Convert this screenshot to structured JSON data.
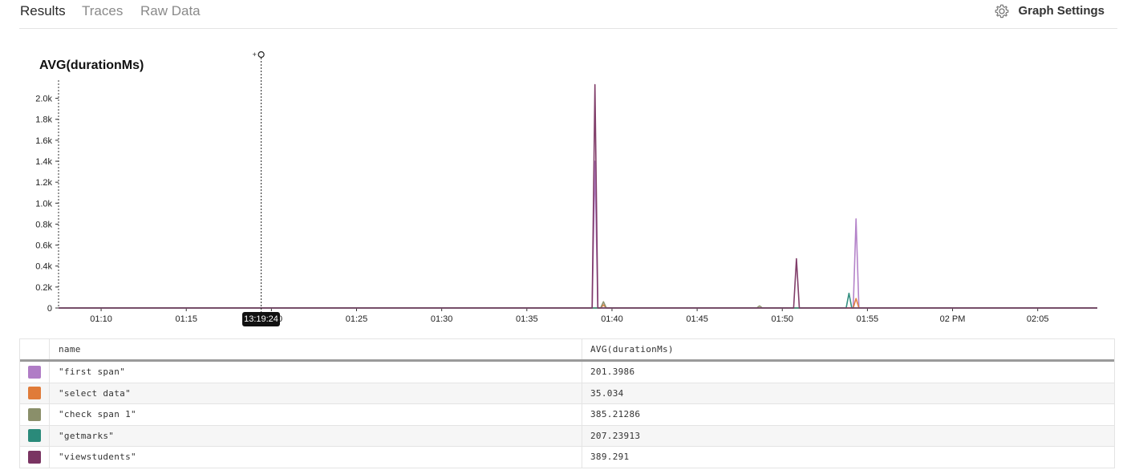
{
  "tabs": [
    {
      "label": "Results",
      "active": true
    },
    {
      "label": "Traces",
      "active": false
    },
    {
      "label": "Raw Data",
      "active": false
    }
  ],
  "graph_settings": {
    "label": "Graph Settings",
    "icon": "gear-icon"
  },
  "chart_data": {
    "type": "line",
    "title": "AVG(durationMs)",
    "xlabel": "",
    "ylabel": "",
    "x_ticks": [
      "01:10",
      "01:15",
      "01:20",
      "01:25",
      "01:30",
      "01:35",
      "01:40",
      "01:45",
      "01:50",
      "01:55",
      "02 PM",
      "02:05"
    ],
    "x_range": [
      "01:07:30",
      "02:08:30"
    ],
    "y_ticks": [
      "0",
      "0.2k",
      "0.4k",
      "0.6k",
      "0.8k",
      "1.0k",
      "1.2k",
      "1.4k",
      "1.6k",
      "1.8k",
      "2.0k"
    ],
    "ylim": [
      0,
      2150
    ],
    "grid": false,
    "hover_time": "13:19:24",
    "hover_x": "01:19:24",
    "series": [
      {
        "name": "\"first span\"",
        "color": "#b07cc6",
        "points": [
          [
            "01:38:50",
            0
          ],
          [
            "01:39:00",
            1400
          ],
          [
            "01:39:10",
            0
          ],
          [
            "01:54:10",
            0
          ],
          [
            "01:54:20",
            850
          ],
          [
            "01:54:30",
            0
          ]
        ]
      },
      {
        "name": "\"select data\"",
        "color": "#e07b39",
        "points": [
          [
            "01:39:20",
            0
          ],
          [
            "01:39:30",
            30
          ],
          [
            "01:39:40",
            0
          ],
          [
            "01:54:10",
            0
          ],
          [
            "01:54:20",
            90
          ],
          [
            "01:54:30",
            0
          ]
        ]
      },
      {
        "name": "\"check span 1\"",
        "color": "#8a8f6a",
        "points": [
          [
            "01:39:20",
            0
          ],
          [
            "01:39:30",
            60
          ],
          [
            "01:39:40",
            0
          ],
          [
            "01:48:30",
            0
          ],
          [
            "01:48:40",
            20
          ],
          [
            "01:48:50",
            0
          ]
        ]
      },
      {
        "name": "\"getmarks\"",
        "color": "#2a8a7a",
        "points": [
          [
            "01:53:45",
            0
          ],
          [
            "01:53:55",
            140
          ],
          [
            "01:54:05",
            0
          ]
        ]
      },
      {
        "name": "\"viewstudents\"",
        "color": "#7a3462",
        "points": [
          [
            "01:38:50",
            0
          ],
          [
            "01:39:00",
            2130
          ],
          [
            "01:39:10",
            0
          ],
          [
            "01:50:40",
            0
          ],
          [
            "01:50:50",
            470
          ],
          [
            "01:51:00",
            0
          ]
        ]
      }
    ]
  },
  "table": {
    "headers": [
      "name",
      "AVG(durationMs)"
    ],
    "rows": [
      {
        "name": "\"first span\"",
        "value": "201.3986",
        "color": "#b07cc6"
      },
      {
        "name": "\"select data\"",
        "value": "35.034",
        "color": "#e07b39"
      },
      {
        "name": "\"check span 1\"",
        "value": "385.21286",
        "color": "#8a8f6a"
      },
      {
        "name": "\"getmarks\"",
        "value": "207.23913",
        "color": "#2a8a7a"
      },
      {
        "name": "\"viewstudents\"",
        "value": "389.291",
        "color": "#7a3462"
      }
    ]
  }
}
